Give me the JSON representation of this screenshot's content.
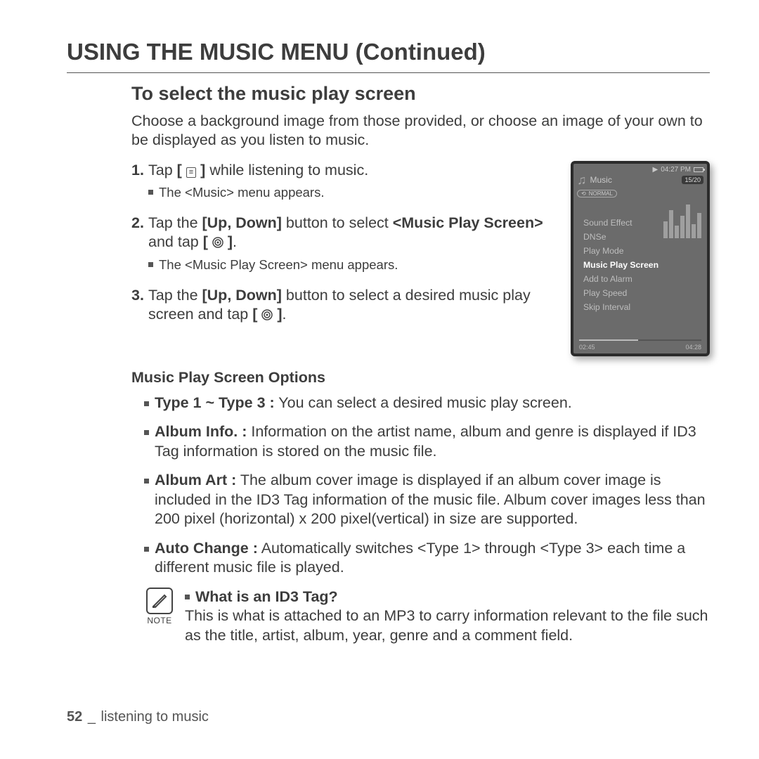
{
  "title": "USING THE MUSIC MENU (Continued)",
  "subhead": "To select the music play screen",
  "intro": "Choose a background image from those provided, or choose an image of your own to be displayed as you listen to music.",
  "steps": {
    "s1_pre": "Tap ",
    "s1_post": " while listening to music.",
    "s1_sub": "The <Music> menu appears.",
    "s2_a": "Tap the ",
    "s2_b": "[Up, Down]",
    "s2_c": " button to select ",
    "s2_d": "<Music Play Screen>",
    "s2_e": " and tap ",
    "s2_post": ".",
    "s2_sub": "The <Music Play Screen> menu appears.",
    "s3_a": "Tap the ",
    "s3_b": "[Up, Down]",
    "s3_c": " button to select a desired music play screen and tap ",
    "s3_post": "."
  },
  "device": {
    "time": "04:27 PM",
    "header": "Music",
    "count": "15/20",
    "mode": "NORMAL",
    "menu": [
      "Sound Effect",
      "DNSe",
      "Play Mode",
      "Music Play Screen",
      "Add to Alarm",
      "Play Speed",
      "Skip Interval"
    ],
    "selected_index": 3,
    "t_left": "02:45",
    "t_right": "04:28"
  },
  "options_head": "Music Play Screen Options",
  "options": {
    "o1_label": "Type 1 ~ Type 3 :",
    "o1_text": " You can select a desired music play screen.",
    "o2_label": "Album Info. :",
    "o2_text": " Information on the artist name, album and genre is displayed if ID3 Tag information is stored on the music file.",
    "o3_label": "Album Art :",
    "o3_text": " The album cover image is displayed if an album cover image is included in the ID3 Tag information of the music file. Album cover images less than 200 pixel (horizontal) x 200 pixel(vertical) in size are supported.",
    "o4_label": "Auto Change :",
    "o4_text": " Automatically switches <Type 1> through <Type 3> each time a different music file is played."
  },
  "note": {
    "label": "NOTE",
    "heading": "What is an ID3 Tag?",
    "body": "This is what is attached to an MP3 to carry information relevant to the file such as the title, artist, album, year, genre and a comment field."
  },
  "footer": {
    "page": "52",
    "section": "listening to music"
  }
}
